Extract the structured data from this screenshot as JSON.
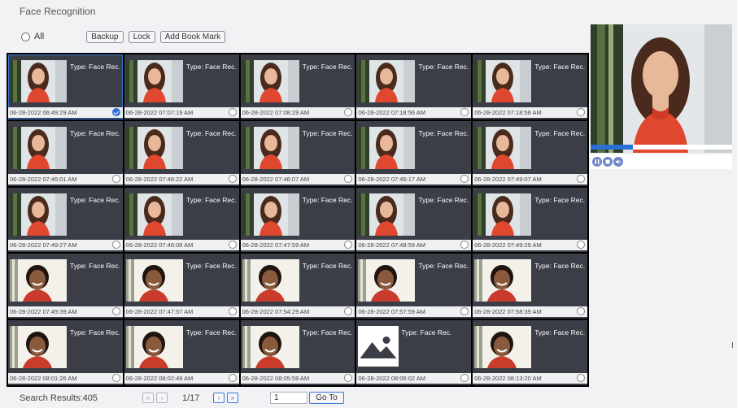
{
  "page_title": "Face Recognition",
  "toolbar": {
    "all_label": "All",
    "backup_label": "Backup",
    "lock_label": "Lock",
    "bookmark_label": "Add Book Mark"
  },
  "records": [
    {
      "type": "Type: Face Rec.",
      "timestamp": "06-28-2022 06:49:29 AM",
      "thumb": "woman",
      "checked": true
    },
    {
      "type": "Type: Face Rec.",
      "timestamp": "06-28-2022 07:07:19 AM",
      "thumb": "woman",
      "checked": false
    },
    {
      "type": "Type: Face Rec.",
      "timestamp": "06-28-2022 07:08:29 AM",
      "thumb": "woman",
      "checked": false
    },
    {
      "type": "Type: Face Rec.",
      "timestamp": "06-28-2022 07:18:56 AM",
      "thumb": "woman",
      "checked": false
    },
    {
      "type": "Type: Face Rec.",
      "timestamp": "06-28-2022 07:18:58 AM",
      "thumb": "woman",
      "checked": false
    },
    {
      "type": "Type: Face Rec.",
      "timestamp": "06-28-2022 07:46:01 AM",
      "thumb": "woman",
      "checked": false
    },
    {
      "type": "Type: Face Rec.",
      "timestamp": "06-28-2022 07:48:22 AM",
      "thumb": "woman",
      "checked": false
    },
    {
      "type": "Type: Face Rec.",
      "timestamp": "06-28-2022 07:46:07 AM",
      "thumb": "woman",
      "checked": false
    },
    {
      "type": "Type: Face Rec.",
      "timestamp": "06-28-2022 07:46:17 AM",
      "thumb": "woman",
      "checked": false
    },
    {
      "type": "Type: Face Rec.",
      "timestamp": "06-28-2022 07:49:07 AM",
      "thumb": "woman",
      "checked": false
    },
    {
      "type": "Type: Face Rec.",
      "timestamp": "06-28-2022 07:49:27 AM",
      "thumb": "woman",
      "checked": false
    },
    {
      "type": "Type: Face Rec.",
      "timestamp": "06-28-2022 07:46:08 AM",
      "thumb": "woman",
      "checked": false
    },
    {
      "type": "Type: Face Rec.",
      "timestamp": "06-28-2022 07:47:59 AM",
      "thumb": "woman",
      "checked": false
    },
    {
      "type": "Type: Face Rec.",
      "timestamp": "06-28-2022 07:48:59 AM",
      "thumb": "woman",
      "checked": false
    },
    {
      "type": "Type: Face Rec.",
      "timestamp": "06-28-2022 07:49:29 AM",
      "thumb": "woman",
      "checked": false
    },
    {
      "type": "Type: Face Rec.",
      "timestamp": "06-28-2022 07:49:39 AM",
      "thumb": "man",
      "checked": false
    },
    {
      "type": "Type: Face Rec.",
      "timestamp": "06-28-2022 07:47:57 AM",
      "thumb": "man",
      "checked": false
    },
    {
      "type": "Type: Face Rec.",
      "timestamp": "06-28-2022 07:54:29 AM",
      "thumb": "man",
      "checked": false
    },
    {
      "type": "Type: Face Rec.",
      "timestamp": "06-28-2022 07:57:59 AM",
      "thumb": "man",
      "checked": false
    },
    {
      "type": "Type: Face Rec.",
      "timestamp": "06-28-2022 07:58:39 AM",
      "thumb": "man",
      "checked": false
    },
    {
      "type": "Type: Face Rec.",
      "timestamp": "06-28-2022 08:01:26 AM",
      "thumb": "man",
      "checked": false
    },
    {
      "type": "Type: Face Rec.",
      "timestamp": "06-28-2022 08:02:49 AM",
      "thumb": "man",
      "checked": false
    },
    {
      "type": "Type: Face Rec.",
      "timestamp": "06-28-2022 08:05:59 AM",
      "thumb": "man",
      "checked": false
    },
    {
      "type": "Type: Face Rec.",
      "timestamp": "06-28-2022 08:06:02 AM",
      "thumb": "image-placeholder-icon",
      "checked": false
    },
    {
      "type": "Type: Face Rec.",
      "timestamp": "06-28-2022 08:13:20 AM",
      "thumb": "man",
      "checked": false
    }
  ],
  "preview": {
    "progress": 0.3,
    "controls": [
      "pause-icon",
      "stop-icon",
      "volume-icon"
    ]
  },
  "footer": {
    "results_label": "Search Results:405",
    "first_label": "«",
    "prev_label": "‹",
    "page_indicator": "1/17",
    "next_label": "›",
    "last_label": "»",
    "page_input": "1",
    "goto_label": "Go To"
  },
  "colors": {
    "accent": "#2a6fd6",
    "cell_bg": "#3b3d47",
    "grid_border": "#000000"
  }
}
